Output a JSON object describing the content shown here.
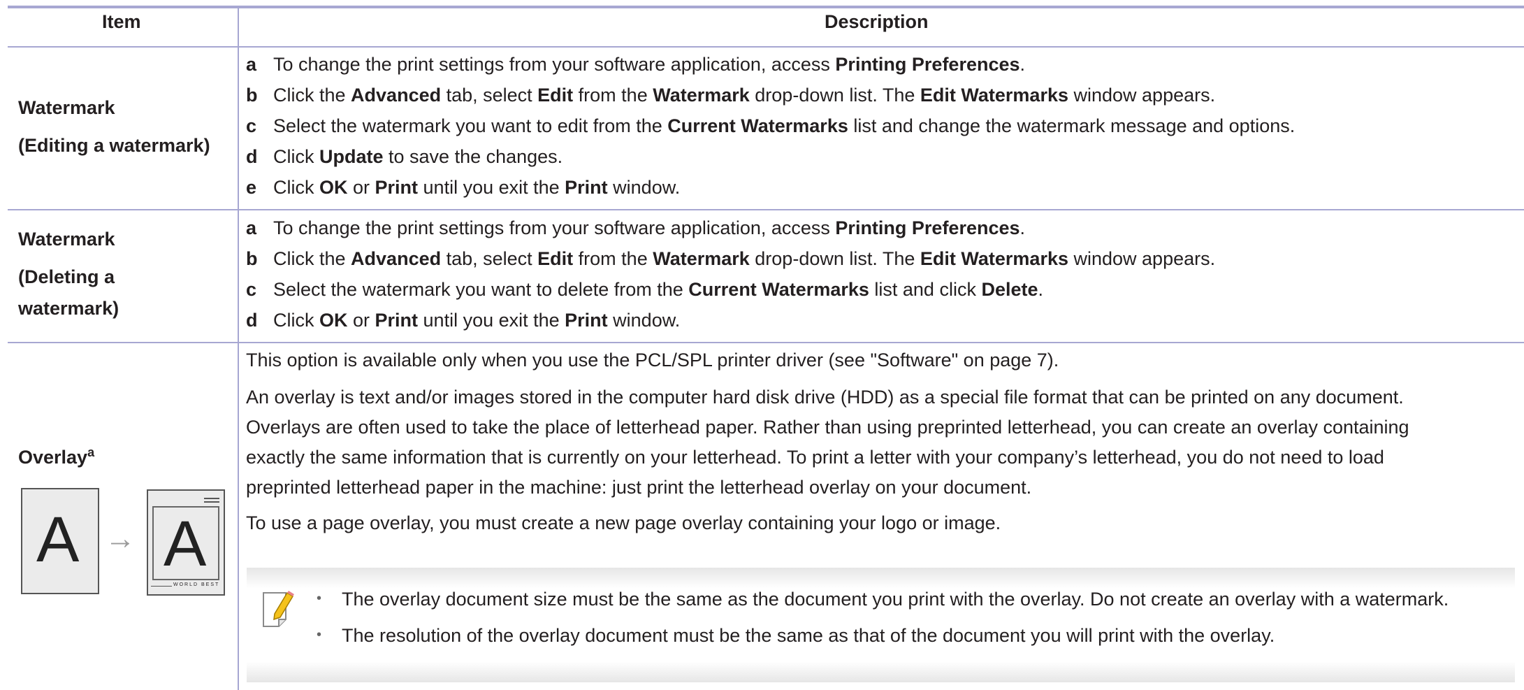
{
  "header": {
    "item": "Item",
    "description": "Description"
  },
  "rows": [
    {
      "item_line1": "Watermark",
      "item_line2": "(Editing a watermark)",
      "steps": [
        {
          "letter": "a",
          "parts": [
            "To change the print settings from your software application, access ",
            "Printing Preferences",
            "."
          ]
        },
        {
          "letter": "b",
          "parts": [
            "Click the ",
            "Advanced",
            " tab, select ",
            "Edit",
            " from the ",
            "Watermark",
            " drop-down list. The ",
            "Edit Watermarks",
            " window appears."
          ]
        },
        {
          "letter": "c",
          "parts": [
            "Select the watermark you want to edit from the ",
            "Current Watermarks",
            " list and change the watermark message and options."
          ]
        },
        {
          "letter": "d",
          "parts": [
            "Click ",
            "Update",
            " to save the changes."
          ]
        },
        {
          "letter": "e",
          "parts": [
            "Click ",
            "OK",
            " or ",
            "Print",
            " until you exit the ",
            "Print",
            " window."
          ]
        }
      ]
    },
    {
      "item_line1": "Watermark",
      "item_line2": "(Deleting a",
      "item_line3": "watermark)",
      "steps": [
        {
          "letter": "a",
          "parts": [
            "To change the print settings from your software application, access ",
            "Printing Preferences",
            "."
          ]
        },
        {
          "letter": "b",
          "parts": [
            "Click the ",
            "Advanced",
            " tab, select ",
            "Edit",
            " from the ",
            "Watermark",
            " drop-down list. The ",
            "Edit Watermarks",
            " window appears."
          ]
        },
        {
          "letter": "c",
          "parts": [
            "Select the watermark you want to delete from the ",
            "Current Watermarks",
            " list and click ",
            "Delete",
            "."
          ]
        },
        {
          "letter": "d",
          "parts": [
            "Click ",
            "OK",
            " or ",
            "Print",
            " until you exit the ",
            "Print",
            " window."
          ]
        }
      ]
    },
    {
      "item_line1": "Overlay",
      "item_sup": "a",
      "intro": "This option is available only when you use the PCL/SPL printer driver (see \"Software\" on page 7).",
      "para_lines": [
        "An overlay is text and/or images stored in the computer hard disk drive (HDD) as a special file format that can be printed on any document.",
        "Overlays are often used to take the place of letterhead paper. Rather than using preprinted letterhead, you can create an overlay containing",
        "exactly the same information that is currently on your letterhead. To print a letter with your company’s letterhead, you do not need to load",
        "preprinted letterhead paper in the machine: just print the letterhead overlay on your document."
      ],
      "usage": "To use a page overlay, you must create a new page overlay containing your logo or image.",
      "illustration": {
        "letter_left": "A",
        "letter_right": "A",
        "arrow": "→",
        "footer_text": "WORLD BEST"
      },
      "note_icon": "note-pencil-icon",
      "notes": [
        "The overlay document size must be the same as the document you print with the overlay. Do not create an overlay with a watermark.",
        "The resolution of the overlay document must be the same as that of the document you will print with the overlay."
      ],
      "bullet": "•"
    }
  ]
}
